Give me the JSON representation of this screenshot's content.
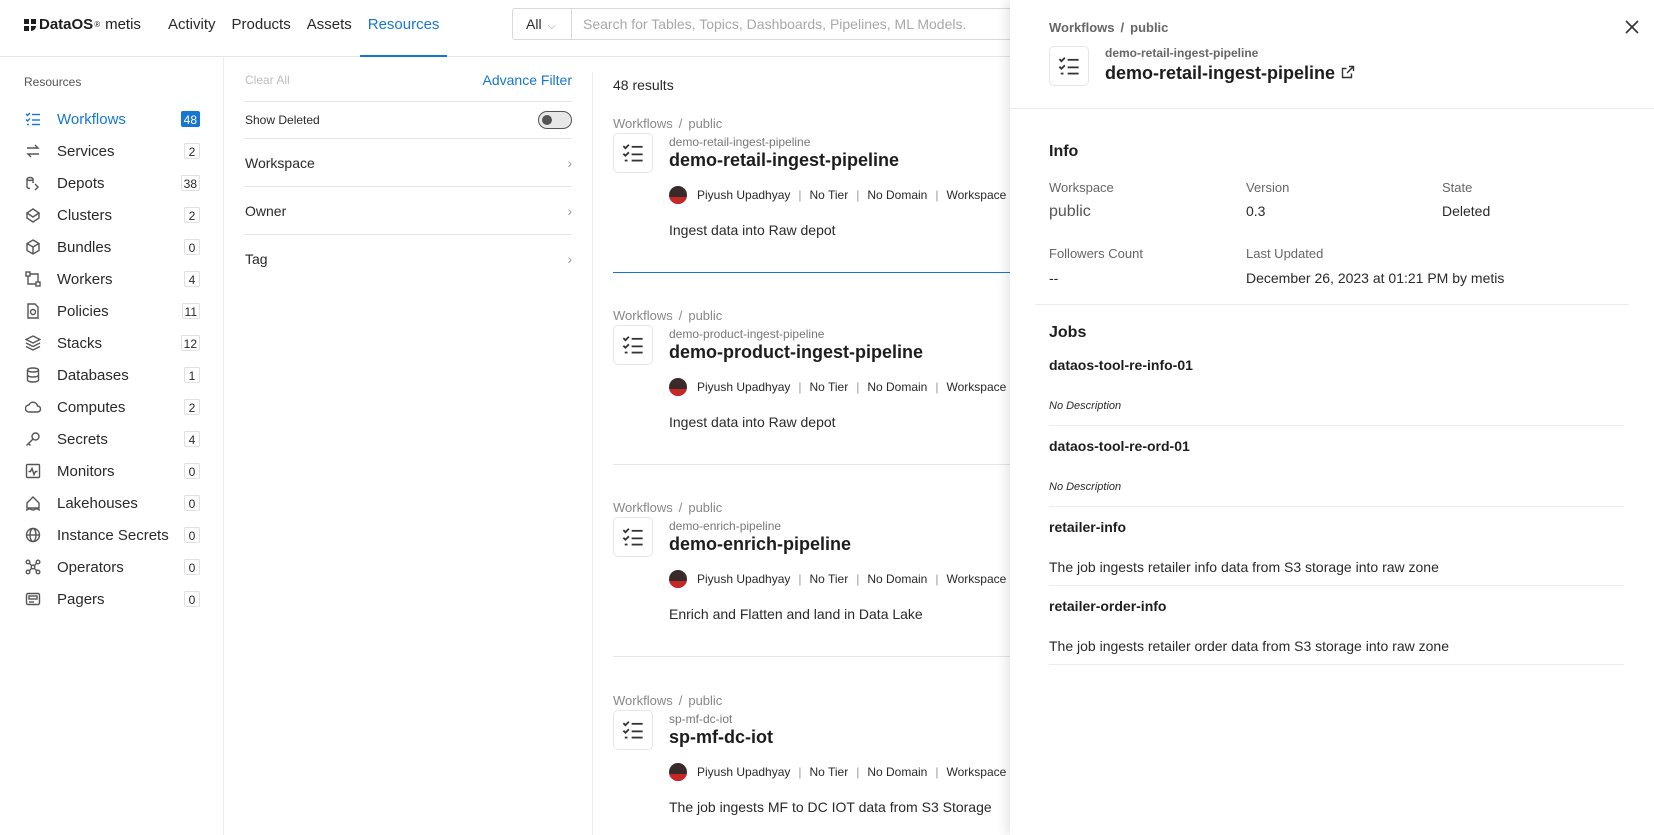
{
  "brand": {
    "name": "DataOS",
    "reg": "®",
    "product": "metis"
  },
  "nav": {
    "activity": "Activity",
    "products": "Products",
    "assets": "Assets",
    "resources": "Resources"
  },
  "search": {
    "scope": "All",
    "placeholder": "Search for Tables, Topics, Dashboards, Pipelines, ML Models."
  },
  "sidebar": {
    "heading": "Resources",
    "items": [
      {
        "label": "Workflows",
        "count": "48"
      },
      {
        "label": "Services",
        "count": "2"
      },
      {
        "label": "Depots",
        "count": "38"
      },
      {
        "label": "Clusters",
        "count": "2"
      },
      {
        "label": "Bundles",
        "count": "0"
      },
      {
        "label": "Workers",
        "count": "4"
      },
      {
        "label": "Policies",
        "count": "11"
      },
      {
        "label": "Stacks",
        "count": "12"
      },
      {
        "label": "Databases",
        "count": "1"
      },
      {
        "label": "Computes",
        "count": "2"
      },
      {
        "label": "Secrets",
        "count": "4"
      },
      {
        "label": "Monitors",
        "count": "0"
      },
      {
        "label": "Lakehouses",
        "count": "0"
      },
      {
        "label": "Instance Secrets",
        "count": "0"
      },
      {
        "label": "Operators",
        "count": "0"
      },
      {
        "label": "Pagers",
        "count": "0"
      }
    ]
  },
  "filters": {
    "clear_all": "Clear All",
    "advance_filter": "Advance Filter",
    "show_deleted": "Show Deleted",
    "show_deleted_on": false,
    "groups": [
      "Workspace",
      "Owner",
      "Tag"
    ]
  },
  "results": {
    "count_text": "48 results",
    "cards": [
      {
        "crumb_type": "Workflows",
        "crumb_ws": "public",
        "subtitle": "demo-retail-ingest-pipeline",
        "title": "demo-retail-ingest-pipeline",
        "owner": "Piyush Upadhyay",
        "tier": "No Tier",
        "domain": "No Domain",
        "workspace": "Workspace",
        "description": "Ingest data into Raw depot"
      },
      {
        "crumb_type": "Workflows",
        "crumb_ws": "public",
        "subtitle": "demo-product-ingest-pipeline",
        "title": "demo-product-ingest-pipeline",
        "owner": "Piyush Upadhyay",
        "tier": "No Tier",
        "domain": "No Domain",
        "workspace": "Workspace",
        "description": "Ingest data into Raw depot"
      },
      {
        "crumb_type": "Workflows",
        "crumb_ws": "public",
        "subtitle": "demo-enrich-pipeline",
        "title": "demo-enrich-pipeline",
        "owner": "Piyush Upadhyay",
        "tier": "No Tier",
        "domain": "No Domain",
        "workspace": "Workspace",
        "description": "Enrich and Flatten and land in Data Lake"
      },
      {
        "crumb_type": "Workflows",
        "crumb_ws": "public",
        "subtitle": "sp-mf-dc-iot",
        "title": "sp-mf-dc-iot",
        "owner": "Piyush Upadhyay",
        "tier": "No Tier",
        "domain": "No Domain",
        "workspace": "Workspace",
        "description": "The job ingests MF to DC IOT data from S3 Storage"
      }
    ]
  },
  "drawer": {
    "crumb_type": "Workflows",
    "crumb_ws": "public",
    "subtitle": "demo-retail-ingest-pipeline",
    "title": "demo-retail-ingest-pipeline",
    "info_heading": "Info",
    "workspace_label": "Workspace",
    "workspace_value": "public",
    "version_label": "Version",
    "version_value": "0.3",
    "state_label": "State",
    "state_value": "Deleted",
    "followers_label": "Followers Count",
    "followers_value": "--",
    "updated_label": "Last Updated",
    "updated_value": "December 26, 2023 at 01:21 PM by metis",
    "jobs_heading": "Jobs",
    "jobs": [
      {
        "name": "dataos-tool-re-info-01",
        "description": "No Description"
      },
      {
        "name": "dataos-tool-re-ord-01",
        "description": "No Description"
      },
      {
        "name": "retailer-info",
        "description": "The job ingests retailer info data from S3 storage into raw zone"
      },
      {
        "name": "retailer-order-info",
        "description": "The job ingests retailer order data from S3 storage into raw zone"
      }
    ]
  },
  "colors": {
    "accent": "#1677d2",
    "text": "#292929",
    "muted": "#888888"
  }
}
